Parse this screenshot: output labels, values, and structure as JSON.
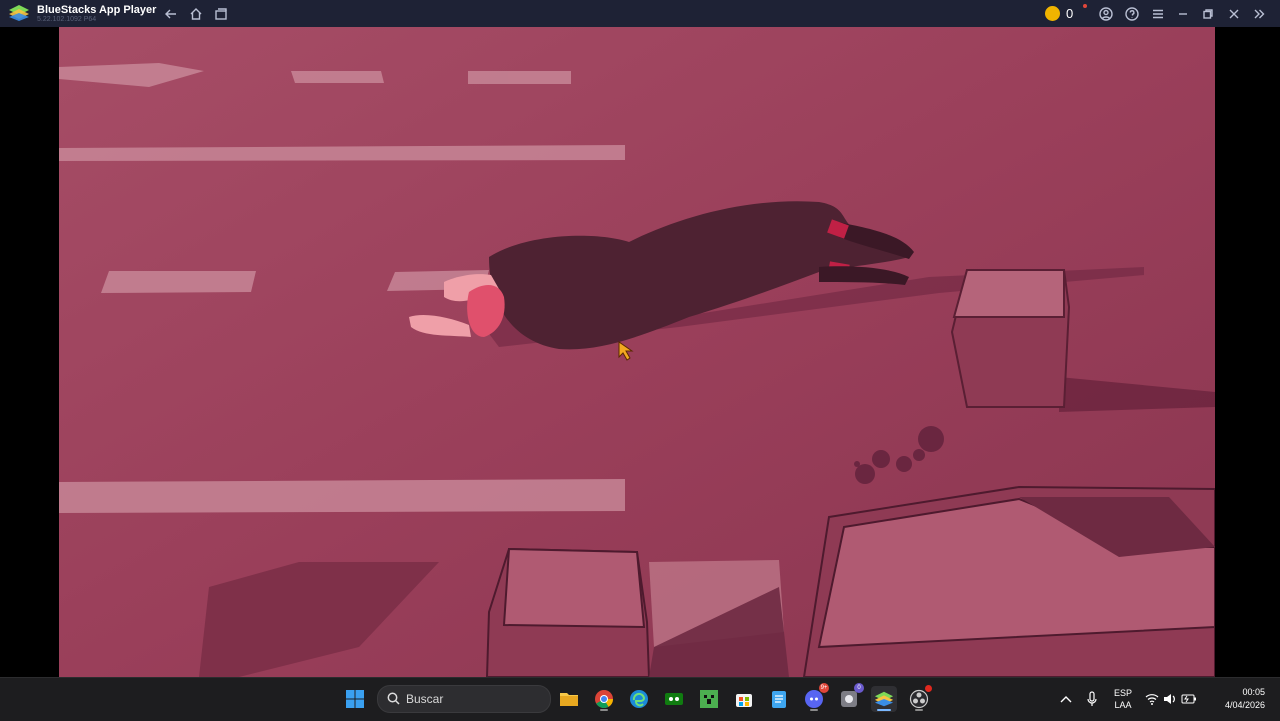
{
  "window": {
    "title": "BlueStacks App Player",
    "version": "5.22.102.1092 P64",
    "coins": "0"
  },
  "colors": {
    "titlebar_bg": "#1e2235",
    "game_tint": "#9a3f5a",
    "coin": "#f0b400",
    "taskbar_bg": "#1d1d1f"
  },
  "titlebar_icons": [
    "back-arrow-icon",
    "home-icon",
    "multi-instance-icon",
    "coin-icon",
    "account-icon",
    "help-icon",
    "menu-icon",
    "minimize-icon",
    "restore-icon",
    "close-icon",
    "sidebar-expand-icon"
  ],
  "taskbar": {
    "search_placeholder": "Buscar",
    "apps": [
      "windows-start-icon",
      "file-explorer-icon",
      "chrome-icon",
      "edge-icon",
      "xbox-icon",
      "minecraft-icon",
      "store-icon",
      "notepad-icon",
      "discord-icon",
      "app-icon",
      "bluestacks-icon",
      "obs-icon"
    ],
    "discord_badge": "9+",
    "app_badge": "0",
    "language_top": "ESP",
    "language_bottom": "LAA",
    "time": "00:05",
    "date": "4/04/2026"
  }
}
